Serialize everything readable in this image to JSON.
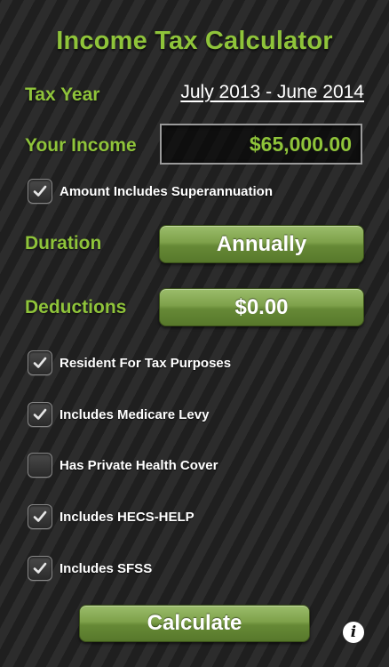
{
  "app": {
    "title": "Income Tax Calculator"
  },
  "form": {
    "tax_year_label": "Tax Year",
    "tax_year_value": "July 2013 - June 2014",
    "income_label": "Your Income",
    "income_value": "$65,000.00",
    "duration_label": "Duration",
    "duration_value": "Annually",
    "deductions_label": "Deductions",
    "deductions_value": "$0.00"
  },
  "options": [
    {
      "label": "Amount Includes Superannuation",
      "checked": true
    },
    {
      "label": "Resident For Tax Purposes",
      "checked": true
    },
    {
      "label": "Includes Medicare Levy",
      "checked": true
    },
    {
      "label": "Has Private Health Cover",
      "checked": false
    },
    {
      "label": "Includes HECS-HELP",
      "checked": true
    },
    {
      "label": "Includes SFSS",
      "checked": true
    }
  ],
  "actions": {
    "calculate_label": "Calculate",
    "info_icon": "info-icon"
  },
  "colors": {
    "accent_green": "#8fc43a",
    "button_green": "#7ea14a",
    "background": "#262626"
  }
}
